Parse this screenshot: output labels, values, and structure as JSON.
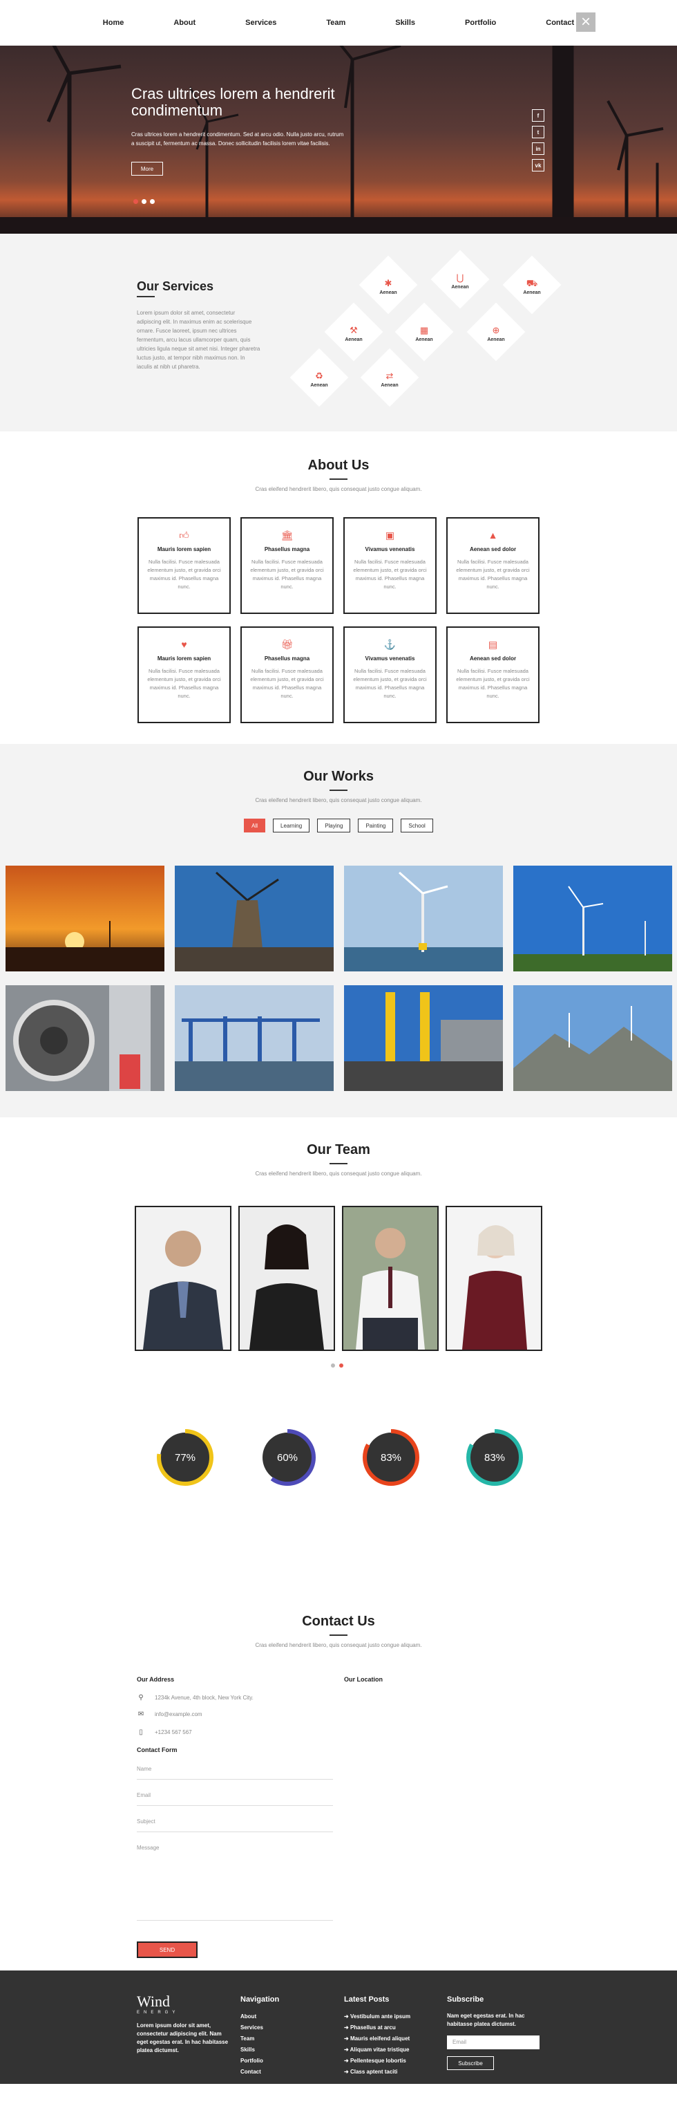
{
  "nav": {
    "items": [
      "Home",
      "About",
      "Services",
      "Team",
      "Skills",
      "Portfolio",
      "Contact"
    ],
    "close_icon": "close-icon"
  },
  "hero": {
    "title": "Cras ultrices lorem a hendrerit condimentum",
    "text": "Cras ultrices lorem a hendrerit condimentum. Sed at arcu odio. Nulla justo arcu, rutrum a suscipit ut, fermentum ac massa. Donec sollicitudin facilisis lorem vitae facilisis.",
    "button_label": "More",
    "social": [
      "f",
      "t",
      "in",
      "vk"
    ]
  },
  "services": {
    "title": "Our Services",
    "text": "Lorem ipsum dolor sit amet, consectetur adipiscing elit. In maximus enim ac scelerisque ornare. Fusce laoreet, ipsum nec ultrices fermentum, arcu lacus ullamcorper quam, quis ultricies ligula neque sit amet nisi. Integer pharetra luctus justo, at tempor nibh maximus non. In iaculis at nibh ut pharetra.",
    "items": [
      {
        "label": "Aenean",
        "icon": "asterisk-icon"
      },
      {
        "label": "Aenean",
        "icon": "magnet-icon"
      },
      {
        "label": "Aenean",
        "icon": "truck-icon"
      },
      {
        "label": "Aenean",
        "icon": "gavel-icon"
      },
      {
        "label": "Aenean",
        "icon": "map-icon"
      },
      {
        "label": "Aenean",
        "icon": "lifebuoy-icon"
      },
      {
        "label": "Aenean",
        "icon": "recycle-icon"
      },
      {
        "label": "Aenean",
        "icon": "exchange-icon"
      }
    ]
  },
  "about": {
    "title": "About Us",
    "subtitle": "Cras eleifend hendrerit libero, quis consequat justo congue aliquam.",
    "cards": [
      {
        "name": "Mauris lorem sapien",
        "desc": "Nulla facilisi. Fusce malesuada elementum justo, et gravida orci maximus id. Phasellus magna nunc.",
        "icon": "thumbs-up-icon"
      },
      {
        "name": "Phasellus magna",
        "desc": "Nulla facilisi. Fusce malesuada elementum justo, et gravida orci maximus id. Phasellus magna nunc.",
        "icon": "bank-icon"
      },
      {
        "name": "Vivamus venenatis",
        "desc": "Nulla facilisi. Fusce malesuada elementum justo, et gravida orci maximus id. Phasellus magna nunc.",
        "icon": "briefcase-icon"
      },
      {
        "name": "Aenean sed dolor",
        "desc": "Nulla facilisi. Fusce malesuada elementum justo, et gravida orci maximus id. Phasellus magna nunc.",
        "icon": "road-icon"
      },
      {
        "name": "Mauris lorem sapien",
        "desc": "Nulla facilisi. Fusce malesuada elementum justo, et gravida orci maximus id. Phasellus magna nunc.",
        "icon": "heart-icon"
      },
      {
        "name": "Phasellus magna",
        "desc": "Nulla facilisi. Fusce malesuada elementum justo, et gravida orci maximus id. Phasellus magna nunc.",
        "icon": "gift-icon"
      },
      {
        "name": "Vivamus venenatis",
        "desc": "Nulla facilisi. Fusce malesuada elementum justo, et gravida orci maximus id. Phasellus magna nunc.",
        "icon": "anchor-icon"
      },
      {
        "name": "Aenean sed dolor",
        "desc": "Nulla facilisi. Fusce malesuada elementum justo, et gravida orci maximus id. Phasellus magna nunc.",
        "icon": "archive-icon"
      }
    ]
  },
  "works": {
    "title": "Our Works",
    "subtitle": "Cras eleifend hendrerit libero, quis consequat justo congue aliquam.",
    "filters": [
      "All",
      "Learning",
      "Playing",
      "Painting",
      "School"
    ],
    "active_filter": "All"
  },
  "team": {
    "title": "Our Team",
    "subtitle": "Cras eleifend hendrerit libero, quis consequat justo congue aliquam."
  },
  "skills": [
    {
      "value": 77,
      "label": "77%",
      "color": "#f0c419"
    },
    {
      "value": 60,
      "label": "60%",
      "color": "#4e4bb8"
    },
    {
      "value": 83,
      "label": "83%",
      "color": "#e8441c"
    },
    {
      "value": 83,
      "label": "83%",
      "color": "#25b7a8"
    }
  ],
  "contact": {
    "title": "Contact Us",
    "subtitle": "Cras eleifend hendrerit libero, quis consequat justo congue aliquam.",
    "address_title": "Our Address",
    "location_title": "Our Location",
    "address": "1234k Avenue, 4th block, New York City.",
    "email": "info@example.com",
    "phone": "+1234 567 567",
    "form_title": "Contact Form",
    "placeholders": {
      "name": "Name",
      "email": "Email",
      "subject": "Subject",
      "message": "Message"
    },
    "send_label": "SEND"
  },
  "footer": {
    "logo": "Wind",
    "logo_sub": "ENERGY",
    "about": "Lorem ipsum dolor sit amet, consectetur adipiscing elit. Nam eget egestas erat. In hac habitasse platea dictumst.",
    "nav_title": "Navigation",
    "nav_items": [
      "About",
      "Services",
      "Team",
      "Skills",
      "Portfolio",
      "Contact"
    ],
    "posts_title": "Latest Posts",
    "posts": [
      "Vestibulum ante ipsum",
      "Phasellus at arcu",
      "Mauris eleifend aliquet",
      "Aliquam vitae tristique",
      "Pellentesque lobortis",
      "Class aptent taciti"
    ],
    "subscribe_title": "Subscribe",
    "subscribe_text": "Nam eget egestas erat. In hac habitasse platea dictumst.",
    "email_placeholder": "Email",
    "subscribe_label": "Subscribe"
  }
}
